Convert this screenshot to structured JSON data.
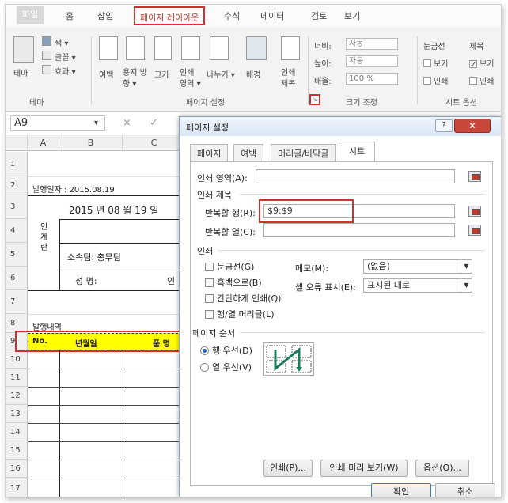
{
  "ribbon": {
    "tabs": [
      "파일",
      "홈",
      "삽입",
      "페이지 레이아웃",
      "수식",
      "데이터",
      "검토",
      "보기"
    ],
    "theme_group": {
      "themes_label": "테마",
      "colors_label": "색 ▾",
      "fonts_label": "글꼴 ▾",
      "effects_label": "효과 ▾",
      "title": "테마"
    },
    "page_setup_group": {
      "margins": "여백",
      "orientation": "용지 방향 ▾",
      "size": "크기",
      "print_area": "인쇄 영역 ▾",
      "breaks": "나누기 ▾",
      "background": "배경",
      "print_titles": "인쇄 제목",
      "title": "페이지 설정"
    },
    "scale_group": {
      "width_label": "너비:",
      "width_value": "자동",
      "height_label": "높이:",
      "height_value": "자동",
      "scale_label": "배율:",
      "scale_value": "100 %",
      "title": "크기 조정"
    },
    "sheet_options_group": {
      "gridlines": "눈금선",
      "headings": "제목",
      "view": "보기",
      "print": "인쇄",
      "title": "시트 옵션"
    }
  },
  "formula_bar": {
    "name_box": "A9",
    "cancel": "×",
    "confirm": "✓"
  },
  "sheet": {
    "columns": [
      "A",
      "B",
      "C"
    ],
    "rows": [
      "1",
      "2",
      "3",
      "4",
      "5",
      "6",
      "7",
      "8",
      "9",
      "10",
      "11",
      "12",
      "13",
      "14",
      "15",
      "16",
      "17"
    ],
    "cells": {
      "issue_date": "발행일자 : 2015.08.19",
      "date_text": "2015 년 08 월 19 일",
      "approval": "인\n계\n란",
      "dept": "소속팀: 총무팀",
      "name_label": "성   명:",
      "seal": "인",
      "history": "발행내역",
      "h_no": "No.",
      "h_date": "년월일",
      "h_item": "품 명"
    }
  },
  "dialog": {
    "title": "페이지 설정",
    "help": "?",
    "close": "✕",
    "tabs": [
      "페이지",
      "여백",
      "머리글/바닥글",
      "시트"
    ],
    "active_tab": "시트",
    "print_area_label": "인쇄 영역(A):",
    "print_titles_section": "인쇄 제목",
    "rows_to_repeat_label": "반복할 행(R):",
    "rows_to_repeat_value": "$9:$9",
    "cols_to_repeat_label": "반복할 열(C):",
    "print_section": "인쇄",
    "gridlines": "눈금선(G)",
    "black_white": "흑백으로(B)",
    "draft": "간단하게 인쇄(Q)",
    "row_col_headings": "행/열 머리글(L)",
    "comments_label": "메모(M):",
    "comments_value": "(없음)",
    "errors_label": "셀 오류 표시(E):",
    "errors_value": "표시된 대로",
    "page_order_section": "페이지 순서",
    "down_then_over": "행 우선(D)",
    "over_then_down": "열 우선(V)",
    "print_button": "인쇄(P)...",
    "preview_button": "인쇄 미리 보기(W)",
    "options_button": "옵션(O)...",
    "ok_button": "확인",
    "cancel_button": "취소"
  },
  "colors": {
    "highlight": "#d32f2f",
    "yellow_fill": "#ffff00"
  }
}
